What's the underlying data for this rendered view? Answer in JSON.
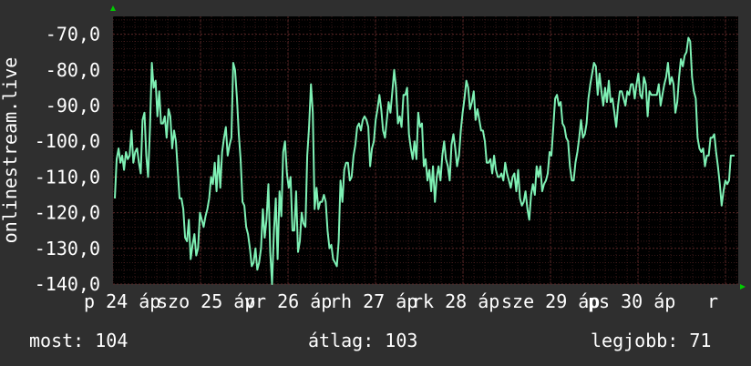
{
  "chart_data": {
    "type": "line",
    "ylabel": "onlinestream.live",
    "ylim": [
      -140,
      -65
    ],
    "yticks": [
      -70,
      -80,
      -90,
      -100,
      -110,
      -120,
      -130,
      -140
    ],
    "ytick_labels": [
      "-70,0",
      "-80,0",
      "-90,0",
      "-100,0",
      "-110,0",
      "-120,0",
      "-130,0",
      "-140,0"
    ],
    "xlabels": [
      "p 24 ápszo 25 ápvr 26 ápth 27 ápk 28 ápsze 29 ápps 30 ápr"
    ],
    "xtick_labels": [
      "p 24 áp",
      "szo 25 áp",
      "vr 26 áp",
      "rh 27 áp",
      "rk 28 áp",
      "sze 29 áp",
      "ps 30 áp",
      "r"
    ],
    "grid": true,
    "line_color": "#7ef0b4",
    "series": [
      {
        "values": [
          -116,
          -105,
          -102,
          -106,
          -104,
          -108,
          -103,
          -105,
          -104,
          -97,
          -106,
          -103,
          -102,
          -106,
          -109,
          -94,
          -92,
          -104,
          -110,
          -96,
          -78,
          -85,
          -83,
          -93,
          -86,
          -95,
          -95,
          -93,
          -99,
          -91,
          -93,
          -102,
          -97,
          -100,
          -108,
          -116,
          -116,
          -119,
          -127,
          -128,
          -122,
          -133,
          -129,
          -126,
          -132,
          -130,
          -120,
          -122,
          -124,
          -121,
          -119,
          -116,
          -110,
          -112,
          -106,
          -114,
          -104,
          -113,
          -103,
          -99,
          -96,
          -104,
          -101,
          -99,
          -78,
          -80,
          -88,
          -98,
          -105,
          -117,
          -118,
          -124,
          -126,
          -130,
          -135,
          -134,
          -130,
          -136,
          -134,
          -130,
          -119,
          -127,
          -122,
          -112,
          -131,
          -140,
          -125,
          -116,
          -133,
          -114,
          -121,
          -103,
          -100,
          -109,
          -113,
          -110,
          -125,
          -125,
          -114,
          -131,
          -128,
          -120,
          -123,
          -124,
          -104,
          -96,
          -84,
          -92,
          -119,
          -113,
          -119,
          -117,
          -117,
          -115,
          -117,
          -125,
          -130,
          -129,
          -133,
          -134,
          -135,
          -128,
          -111,
          -117,
          -108,
          -106,
          -106,
          -111,
          -110,
          -104,
          -101,
          -96,
          -95,
          -97,
          -94,
          -93,
          -94,
          -96,
          -107,
          -102,
          -100,
          -94,
          -91,
          -87,
          -91,
          -97,
          -99,
          -94,
          -89,
          -92,
          -86,
          -80,
          -85,
          -95,
          -93,
          -96,
          -87,
          -87,
          -85,
          -98,
          -102,
          -105,
          -100,
          -105,
          -92,
          -96,
          -95,
          -107,
          -105,
          -111,
          -108,
          -114,
          -107,
          -117,
          -110,
          -107,
          -111,
          -104,
          -100,
          -105,
          -107,
          -111,
          -101,
          -98,
          -102,
          -107,
          -104,
          -97,
          -92,
          -88,
          -83,
          -85,
          -91,
          -89,
          -86,
          -94,
          -91,
          -94,
          -97,
          -97,
          -100,
          -106,
          -106,
          -105,
          -109,
          -104,
          -108,
          -110,
          -110,
          -109,
          -111,
          -106,
          -109,
          -111,
          -113,
          -110,
          -109,
          -114,
          -108,
          -116,
          -118,
          -117,
          -114,
          -119,
          -122,
          -115,
          -112,
          -115,
          -107,
          -110,
          -107,
          -114,
          -112,
          -111,
          -109,
          -103,
          -104,
          -96,
          -88,
          -87,
          -90,
          -89,
          -95,
          -96,
          -99,
          -100,
          -107,
          -111,
          -111,
          -106,
          -103,
          -99,
          -94,
          -99,
          -98,
          -95,
          -88,
          -84,
          -81,
          -78,
          -79,
          -87,
          -81,
          -86,
          -90,
          -85,
          -89,
          -83,
          -89,
          -88,
          -92,
          -96,
          -90,
          -86,
          -86,
          -88,
          -90,
          -86,
          -87,
          -84,
          -84,
          -88,
          -84,
          -81,
          -87,
          -88,
          -82,
          -84,
          -93,
          -86,
          -87,
          -87,
          -87,
          -87,
          -84,
          -90,
          -87,
          -84,
          -82,
          -78,
          -84,
          -82,
          -84,
          -92,
          -89,
          -82,
          -77,
          -79,
          -76,
          -75,
          -71,
          -72,
          -82,
          -86,
          -88,
          -99,
          -102,
          -103,
          -102,
          -107,
          -104,
          -104,
          -99,
          -99,
          -98,
          -103,
          -107,
          -112,
          -118,
          -114,
          -111,
          -112,
          -111,
          -104,
          -104,
          -104
        ]
      }
    ]
  },
  "stats": {
    "current": "most: 104",
    "average": "átlag: 103",
    "best": "legjobb: 71"
  },
  "colors": {
    "background": "#2f2f2f",
    "plot_background": "#000000",
    "grid": "#5a2626",
    "line": "#7ef0b4",
    "arrow": "#00cc00"
  }
}
